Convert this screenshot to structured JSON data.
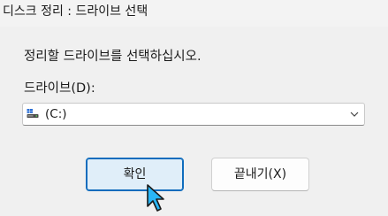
{
  "window": {
    "title": "디스크 정리 : 드라이브 선택"
  },
  "dialog": {
    "prompt": "정리할 드라이브를 선택하십시오.",
    "drive_label": "드라이브(D):",
    "drive_select": {
      "value": "(C:)",
      "icon": "drive-icon"
    }
  },
  "buttons": {
    "ok_label": "확인",
    "close_label": "끝내기(X)"
  },
  "colors": {
    "accent": "#0f6cbd",
    "ok_background": "#e0eef9",
    "cursor": "#29b6f6"
  }
}
